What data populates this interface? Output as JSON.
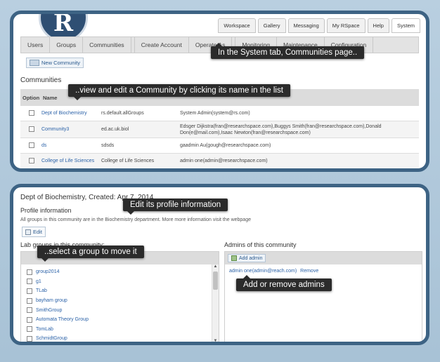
{
  "top_nav": {
    "tabs": [
      "Workspace",
      "Gallery",
      "Messaging",
      "My RSpace",
      "Help",
      "System"
    ],
    "active": "System"
  },
  "system_nav": {
    "tabs": [
      "Users",
      "Groups",
      "Communities",
      "Create Account",
      "Operate As",
      "Monitoring",
      "Maintenance",
      "Configuration"
    ]
  },
  "new_community_label": "New Community",
  "communities_section": {
    "title": "Communities",
    "headers": {
      "option": "Option",
      "name": "Name"
    },
    "rows": [
      {
        "name": "Dept of Biochemistry",
        "unique": "rs.default.allGroups",
        "admins": "System Admin(system@rs.com)"
      },
      {
        "name": "Community3",
        "unique": "ed.ac.uk.biol",
        "admins": "Edsger Dijkstra(fran@researchspace.com),Buggys Smith(fran@researchspace.com),Donald Don(e@mail.com),Isaac Newton(fran@researchspace.com)"
      },
      {
        "name": "ds",
        "unique": "sdsds",
        "admins": "gaadmin Au(gough@researchspace.com)"
      },
      {
        "name": "College of Life Sciences",
        "unique": "College of Life Sciences",
        "admins": "admin one(admin@researchspace.com)"
      }
    ]
  },
  "community_detail": {
    "title": "Dept of Biochemistry, Created: Apr 7, 2014",
    "profile_heading": "Profile information",
    "profile_text": "All groups in this community are in the Biochemistry department. More more information visit the webpage",
    "edit_label": "Edit",
    "lab_groups_heading": "Lab groups in this community:",
    "groups": [
      "group2014",
      "g1",
      "TLab",
      "bayham group",
      "SmithGroup",
      "Automata Theory Group",
      "TomLab",
      "SchmidtGroup"
    ],
    "admins_heading": "Admins of this community",
    "add_admin_label": "Add admin",
    "admin_entry": "admin one(admin@reach.com)",
    "remove_label": "Remove"
  },
  "callouts": {
    "system_tab": "In the System tab, Communities page..",
    "view_edit": "..view and edit a Community by clicking its name in the list",
    "edit_profile": "Edit its profile information",
    "select_group": "..select a group to move it",
    "add_remove_admins": "Add or remove admins"
  },
  "colors": {
    "panel_border": "#3d6384",
    "background": "#b9cfe0",
    "link": "#2b62a8",
    "callout_bg": "#2b2b2b"
  }
}
